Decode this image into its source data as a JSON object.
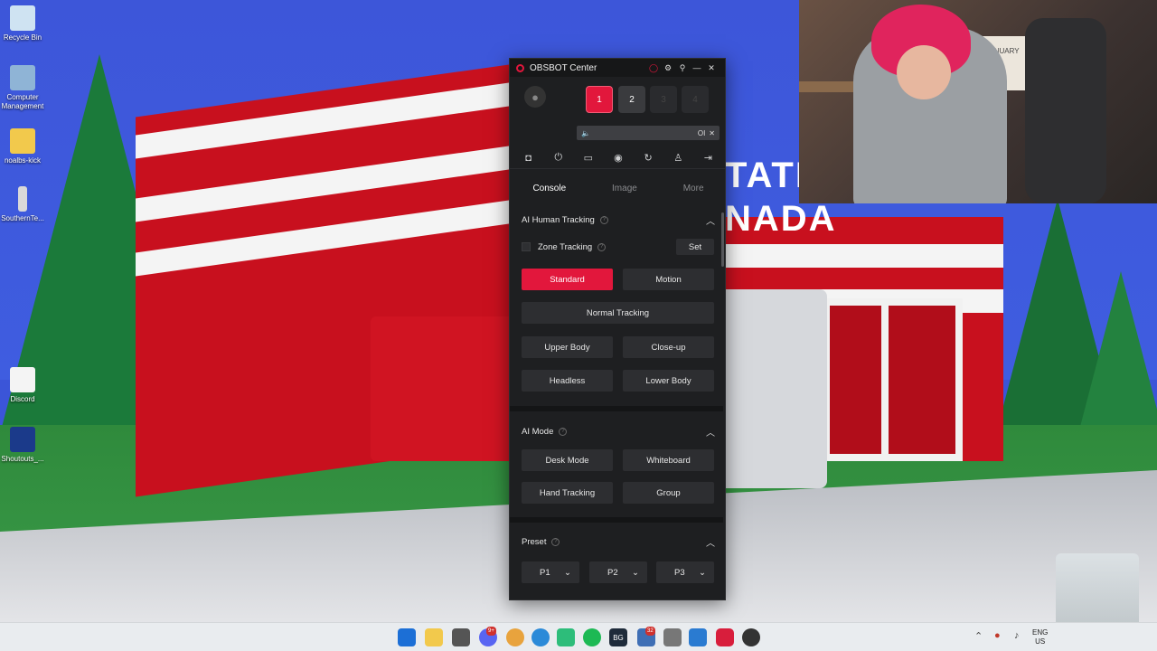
{
  "desktop": {
    "icons": [
      {
        "label": "Recycle Bin"
      },
      {
        "label": "Computer Management"
      },
      {
        "label": "noalbs-kick"
      },
      {
        "label": "SouthernTe..."
      },
      {
        "label": "Discord"
      },
      {
        "label": "Shoutouts_..."
      }
    ],
    "scene_sign": "TATIC\nNADA",
    "webcam_calendar": "JANUARY"
  },
  "window": {
    "title": "OBSBOT Center",
    "controls": {
      "record": "◯",
      "settings": "⚙",
      "pin": "⚲",
      "minimize": "—",
      "close": "✕"
    },
    "device_slots": [
      "1",
      "2",
      "3",
      "4"
    ],
    "active_slot": "1",
    "volume_bar": {
      "left_icon": "🔈",
      "right_text": "OI",
      "close": "✕"
    },
    "toolbar_icons": [
      "camera-icon",
      "power-icon",
      "record-icon",
      "webcam-icon",
      "refresh-icon",
      "person-icon",
      "exit-icon"
    ],
    "tabs": [
      "Console",
      "Image",
      "More"
    ],
    "active_tab": "Console",
    "sections": {
      "ai_tracking": {
        "title": "AI Human Tracking",
        "zone_tracking": "Zone Tracking",
        "set": "Set",
        "standard": "Standard",
        "motion": "Motion",
        "normal_tracking": "Normal Tracking",
        "upper_body": "Upper Body",
        "close_up": "Close-up",
        "headless": "Headless",
        "lower_body": "Lower Body"
      },
      "ai_mode": {
        "title": "AI Mode",
        "desk_mode": "Desk Mode",
        "whiteboard": "Whiteboard",
        "hand_tracking": "Hand Tracking",
        "group": "Group"
      },
      "preset": {
        "title": "Preset",
        "p1": "P1",
        "p2": "P2",
        "p3": "P3"
      }
    }
  },
  "taskbar": {
    "lang_top": "ENG",
    "lang_bottom": "US",
    "badge_discord": "9+",
    "badge_other": "32",
    "bg_label": "BG"
  },
  "colors": {
    "accent": "#e2173c",
    "panel": "#1e1f21",
    "button": "#2d2e31"
  }
}
